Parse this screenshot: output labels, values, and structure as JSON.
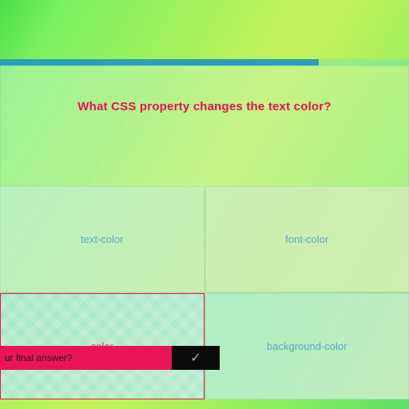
{
  "colors": {
    "accent": "#e91050",
    "timer": "#2b9fb8",
    "confirm_bg": "#eb1458"
  },
  "timer": {
    "percent": 78
  },
  "quiz": {
    "question": "What CSS property changes the text color?",
    "answers": [
      {
        "label": "text-color",
        "selected": false
      },
      {
        "label": "font-color",
        "selected": false
      },
      {
        "label": "color",
        "selected": true
      },
      {
        "label": "background-color",
        "selected": false
      }
    ],
    "confirm_prompt": "ur final answer?",
    "confirm_icon": "✓"
  }
}
